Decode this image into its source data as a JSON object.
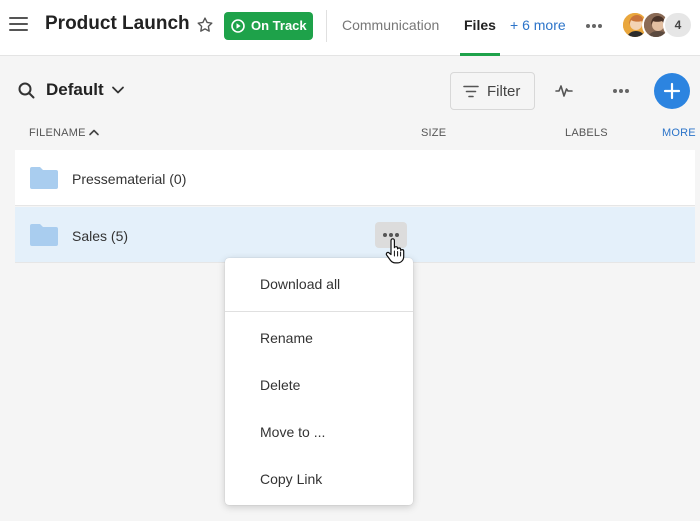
{
  "header": {
    "project_title": "Product Launch",
    "status_label": "On Track",
    "tabs": [
      {
        "label": "Communication"
      },
      {
        "label": "Files"
      },
      {
        "label": "+ 6 more"
      }
    ],
    "avatar_overflow_count": "4"
  },
  "toolbar": {
    "view_label": "Default",
    "filter_label": "Filter"
  },
  "table": {
    "columns": {
      "filename": "FILENAME",
      "size": "SIZE",
      "labels": "LABELS",
      "more": "MORE"
    },
    "rows": [
      {
        "name": "Pressematerial (0)"
      },
      {
        "name": "Sales (5)"
      }
    ]
  },
  "context_menu": {
    "items": [
      {
        "label": "Download all"
      },
      {
        "label": "Rename"
      },
      {
        "label": "Delete"
      },
      {
        "label": "Move to ..."
      },
      {
        "label": "Copy Link"
      }
    ]
  },
  "colors": {
    "accent_green": "#1ea24a",
    "accent_blue": "#2c84e0",
    "selected_row": "#e4f0fa",
    "folder": "#a9cdef"
  },
  "icons": [
    "hamburger-icon",
    "star-icon",
    "play-icon",
    "ellipsis-icon",
    "search-icon",
    "chevron-down-icon",
    "filter-icon",
    "activity-icon",
    "plus-icon",
    "sort-up-icon",
    "folder-icon",
    "hand-cursor-icon"
  ]
}
